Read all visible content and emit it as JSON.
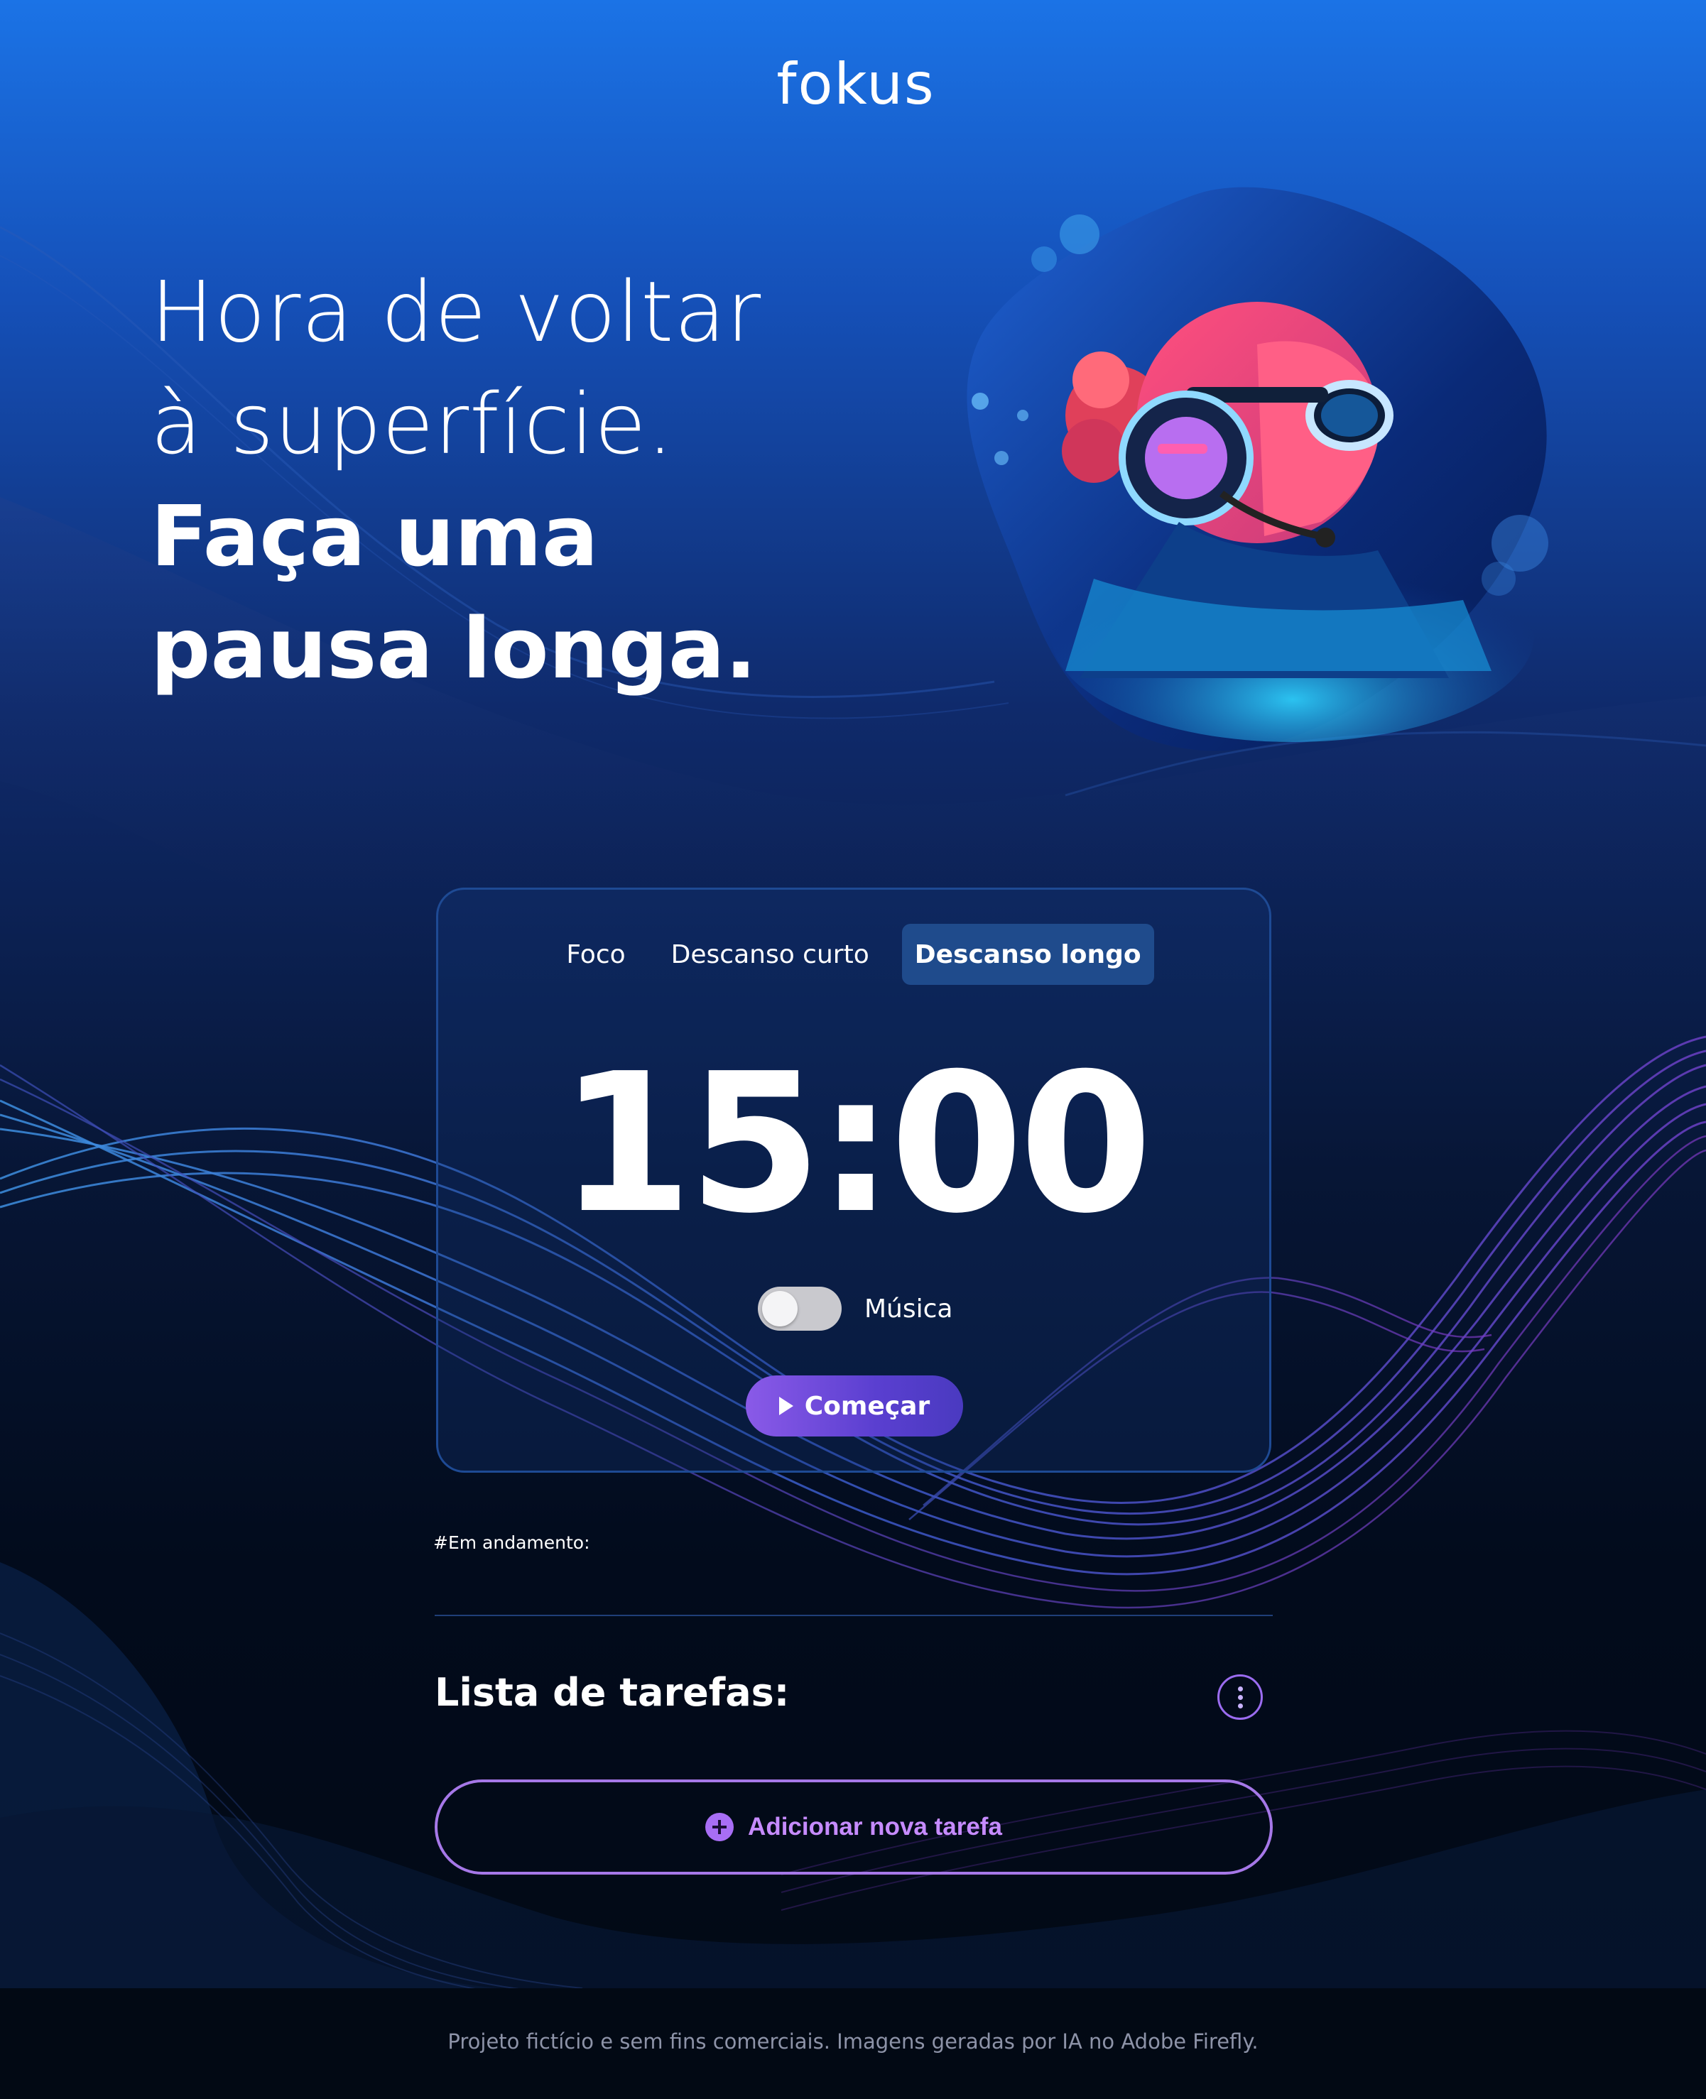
{
  "brand": {
    "name": "fokus"
  },
  "headline": {
    "line1": "Hora de voltar",
    "line2": "à superfície.",
    "line3": "Faça uma",
    "line4": "pausa longa."
  },
  "timer": {
    "tabs": [
      {
        "label": "Foco",
        "active": false
      },
      {
        "label": "Descanso curto",
        "active": false
      },
      {
        "label": "Descanso longo",
        "active": true
      }
    ],
    "time": "15:00",
    "music_label": "Música",
    "music_enabled": false,
    "start_label": "Começar"
  },
  "in_progress_label": "#Em andamento:",
  "tasks": {
    "title": "Lista de tarefas:",
    "add_label": "Adicionar nova tarefa"
  },
  "footer": {
    "text": "Projeto fictício e sem fins comerciais. Imagens geradas por IA no Adobe Firefly."
  },
  "colors": {
    "accent_purple": "#a678e8",
    "active_tab": "#1f4b8c",
    "bg_top": "#1b73e6",
    "bg_bottom": "#020914"
  }
}
